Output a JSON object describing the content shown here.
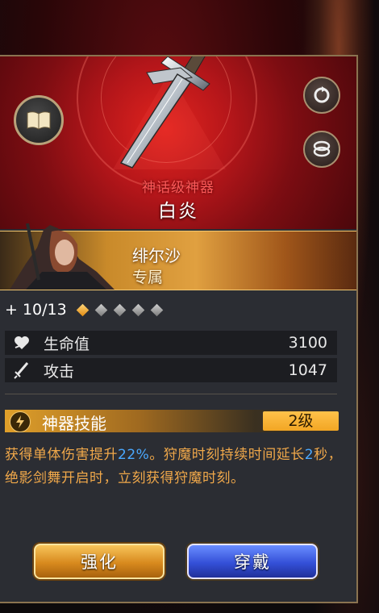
{
  "item": {
    "rarity_label": "神话级神器",
    "name": "白炎"
  },
  "hero": {
    "name": "绯尔沙",
    "tag": "专属"
  },
  "upgrade": {
    "level_text": "+ 10/13",
    "stars_total": 5,
    "stars_filled": 1
  },
  "stats": [
    {
      "label": "生命值",
      "value": "3100",
      "icon": "heart-icon"
    },
    {
      "label": "攻击",
      "value": "1047",
      "icon": "sword-icon"
    }
  ],
  "skill": {
    "title": "神器技能",
    "level": "2级",
    "desc_part1": "获得单体伤害提升",
    "desc_highlight1": "22%",
    "desc_part2": "。狩魔时刻持续时间延长",
    "desc_highlight2": "2",
    "desc_part3": "秒，绝影剑舞开启时，立刻获得狩魔时刻。"
  },
  "buttons": {
    "enhance": "强化",
    "equip": "穿戴"
  },
  "colors": {
    "header_red": "#b5161a",
    "rarity_red": "#ff5a5a",
    "desc_orange": "#f0a84a",
    "highlight_blue": "#4aa8ff",
    "gold": "#f2a624",
    "button_blue": "#3450d8"
  }
}
